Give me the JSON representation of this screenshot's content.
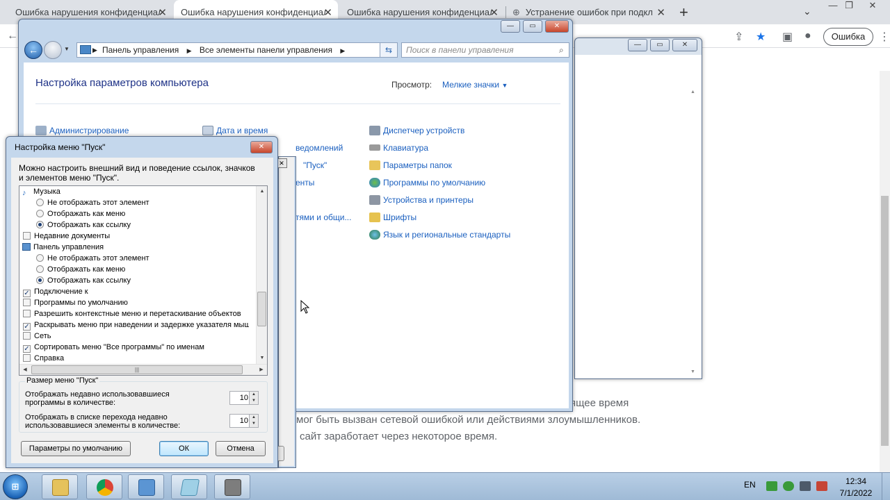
{
  "browser": {
    "tabs": [
      {
        "title": "Ошибка нарушения конфиденциальности"
      },
      {
        "title": "Ошибка нарушения конфиденциальности"
      },
      {
        "title": "Ошибка нарушения конфиденциальности"
      },
      {
        "title": "Устранение ошибок при подключении"
      }
    ],
    "error_button": "Ошибка",
    "page_lines": [
      "ящее время",
      "мог быть вызван сетевой ошибкой или действиями злоумышленников.",
      "сайт заработает через некоторое время."
    ]
  },
  "control_panel": {
    "breadcrumb": [
      "Панель управления",
      "Все элементы панели управления"
    ],
    "search_placeholder": "Поиск в панели управления",
    "title": "Настройка параметров компьютера",
    "view_label": "Просмотр:",
    "view_value": "Мелкие значки",
    "column1": [
      "Администрирование"
    ],
    "column2": [
      "Дата и время",
      "ведомлений",
      "\"Пуск\"",
      "енты",
      "",
      "тями и общи..."
    ],
    "column3": [
      "Диспетчер устройств",
      "Клавиатура",
      "Параметры папок",
      "Программы по умолчанию",
      "Устройства и принтеры",
      "Шрифты",
      "Язык и региональные стандарты"
    ]
  },
  "dialog": {
    "title": "Настройка меню \"Пуск\"",
    "description": "Можно настроить внешний вид и поведение ссылок, значков и элементов меню \"Пуск\".",
    "list": [
      {
        "kind": "group",
        "label": "Музыка",
        "icon": "music-icon"
      },
      {
        "kind": "radio",
        "label": "Не отображать этот элемент",
        "checked": false
      },
      {
        "kind": "radio",
        "label": "Отображать как меню",
        "checked": false
      },
      {
        "kind": "radio",
        "label": "Отображать как ссылку",
        "checked": true
      },
      {
        "kind": "check",
        "label": "Недавние документы",
        "checked": false
      },
      {
        "kind": "group",
        "label": "Панель управления",
        "icon": "control-panel-icon"
      },
      {
        "kind": "radio",
        "label": "Не отображать этот элемент",
        "checked": false
      },
      {
        "kind": "radio",
        "label": "Отображать как меню",
        "checked": false
      },
      {
        "kind": "radio",
        "label": "Отображать как ссылку",
        "checked": true
      },
      {
        "kind": "check",
        "label": "Подключение к",
        "checked": true
      },
      {
        "kind": "check",
        "label": "Программы по умолчанию",
        "checked": false
      },
      {
        "kind": "check",
        "label": "Разрешить контекстные меню и перетаскивание объектов",
        "checked": false
      },
      {
        "kind": "check",
        "label": "Раскрывать меню при наведении и задержке указателя мыши",
        "checked": true
      },
      {
        "kind": "check",
        "label": "Сеть",
        "checked": false
      },
      {
        "kind": "check",
        "label": "Сортировать меню \"Все программы\" по именам",
        "checked": true
      },
      {
        "kind": "check",
        "label": "Справка",
        "checked": false
      }
    ],
    "size_group_label": "Размер меню \"Пуск\"",
    "recent_programs_label": "Отображать недавно использовавшиеся программы в количестве:",
    "recent_programs_value": "10",
    "jump_list_label": "Отображать в списке перехода недавно использовавшиеся элементы в количестве:",
    "jump_list_value": "10",
    "defaults_button": "Параметры по умолчанию",
    "ok_button": "ОК",
    "cancel_button": "Отмена"
  },
  "taskbar": {
    "language": "EN",
    "time": "12:34",
    "date": "7/1/2022"
  }
}
